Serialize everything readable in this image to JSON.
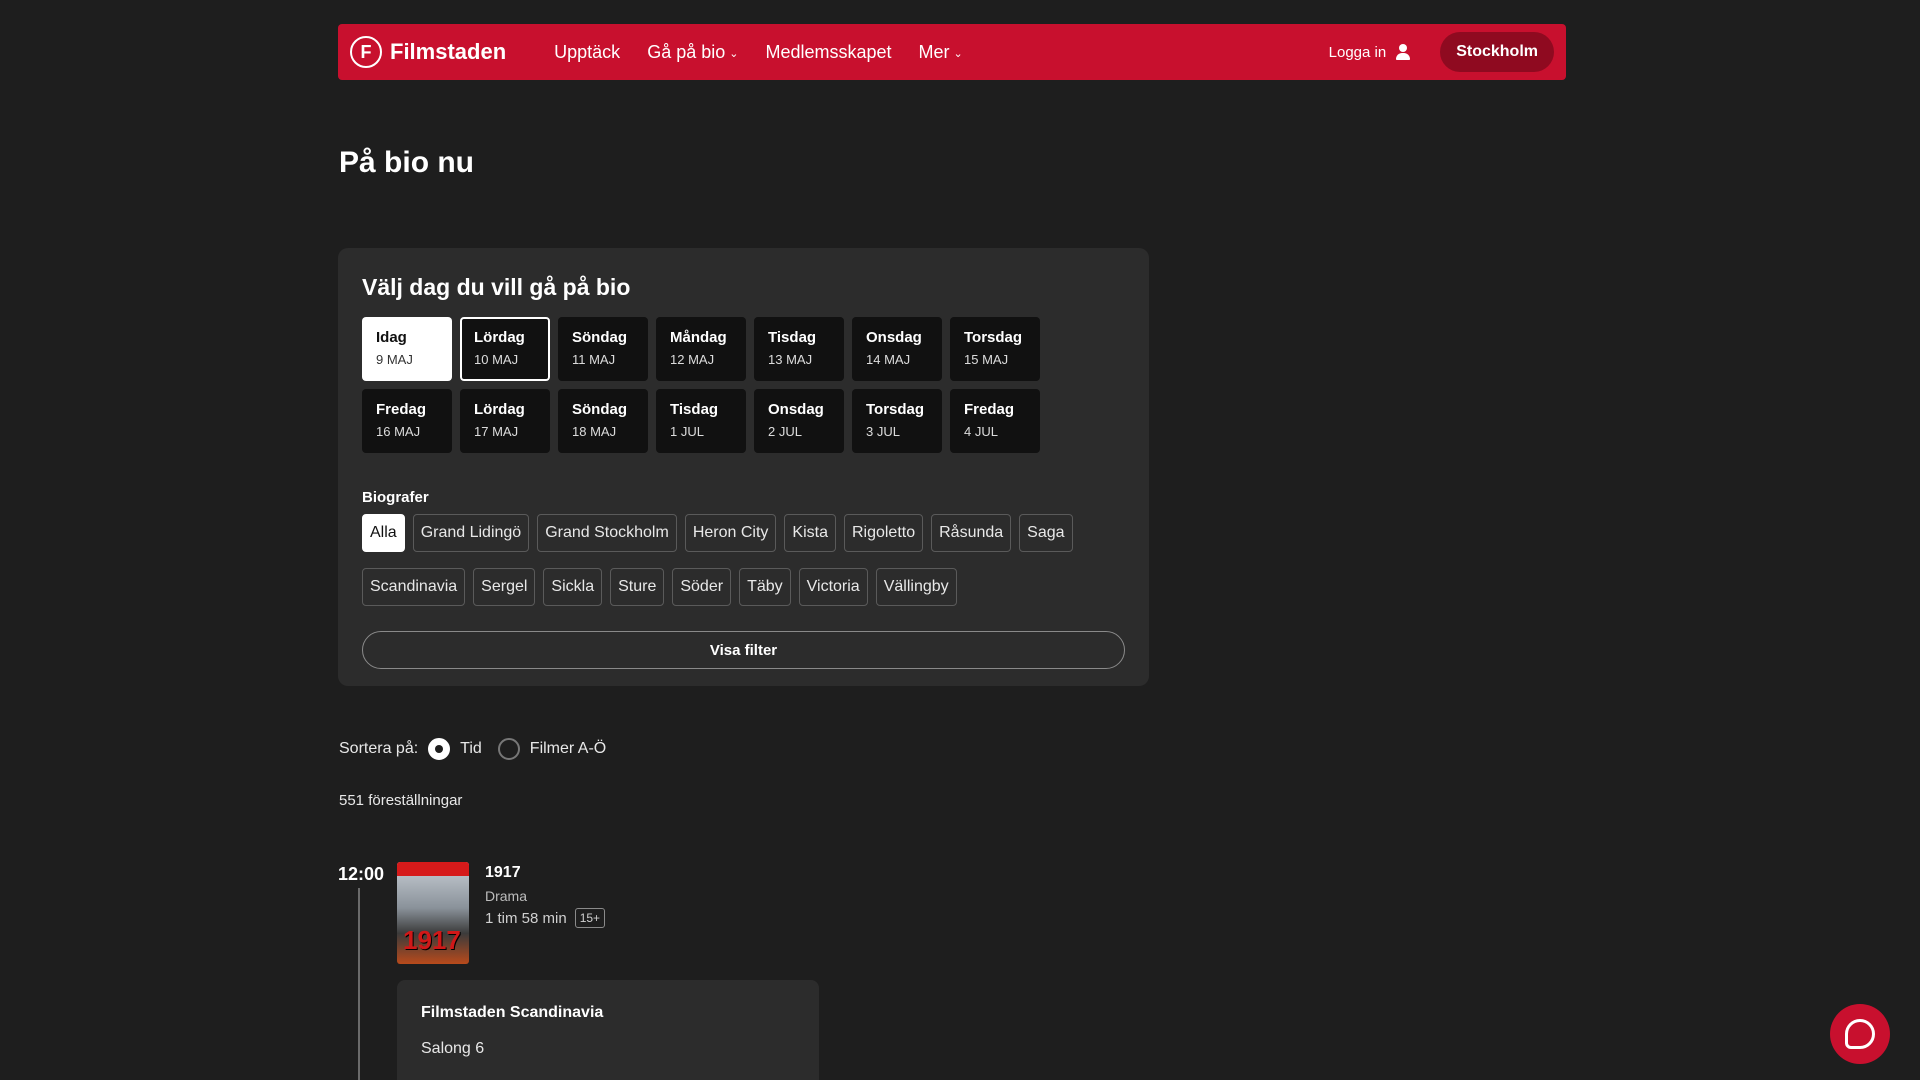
{
  "header": {
    "logo_mark": "F",
    "logo_text": "Filmstaden",
    "nav": [
      {
        "label": "Upptäck",
        "has_dropdown": false
      },
      {
        "label": "Gå på bio",
        "has_dropdown": true
      },
      {
        "label": "Medlemsskapet",
        "has_dropdown": false
      },
      {
        "label": "Mer",
        "has_dropdown": true
      }
    ],
    "login_label": "Logga in",
    "city_label": "Stockholm"
  },
  "page_title": "På bio nu",
  "day_picker": {
    "title": "Välj dag du vill gå på bio",
    "days": [
      {
        "name": "Idag",
        "date": "9 MAJ"
      },
      {
        "name": "Lördag",
        "date": "10 MAJ"
      },
      {
        "name": "Söndag",
        "date": "11 MAJ"
      },
      {
        "name": "Måndag",
        "date": "12 MAJ"
      },
      {
        "name": "Tisdag",
        "date": "13 MAJ"
      },
      {
        "name": "Onsdag",
        "date": "14 MAJ"
      },
      {
        "name": "Torsdag",
        "date": "15 MAJ"
      },
      {
        "name": "Fredag",
        "date": "16 MAJ"
      },
      {
        "name": "Lördag",
        "date": "17 MAJ"
      },
      {
        "name": "Söndag",
        "date": "18 MAJ"
      },
      {
        "name": "Tisdag",
        "date": "1 JUL"
      },
      {
        "name": "Onsdag",
        "date": "2 JUL"
      },
      {
        "name": "Torsdag",
        "date": "3 JUL"
      },
      {
        "name": "Fredag",
        "date": "4 JUL"
      }
    ]
  },
  "cinemas": {
    "label": "Biografer",
    "row1": [
      "Alla",
      "Grand Lidingö",
      "Grand Stockholm",
      "Heron City",
      "Kista",
      "Rigoletto",
      "Råsunda",
      "Saga"
    ],
    "row2": [
      "Scandinavia",
      "Sergel",
      "Sickla",
      "Sture",
      "Söder",
      "Täby",
      "Victoria",
      "Vällingby"
    ]
  },
  "show_filter_label": "Visa filter",
  "sort": {
    "label": "Sortera på:",
    "option_time": "Tid",
    "option_az": "Filmer A-Ö"
  },
  "count_text": "551 föreställningar",
  "listing": {
    "time": "12:00",
    "poster_text": "1917",
    "movie": {
      "title": "1917",
      "genre": "Drama",
      "duration": "1 tim 58 min",
      "age": "15+"
    },
    "card": {
      "cinema": "Filmstaden Scandinavia",
      "salon": "Salong 6"
    }
  }
}
